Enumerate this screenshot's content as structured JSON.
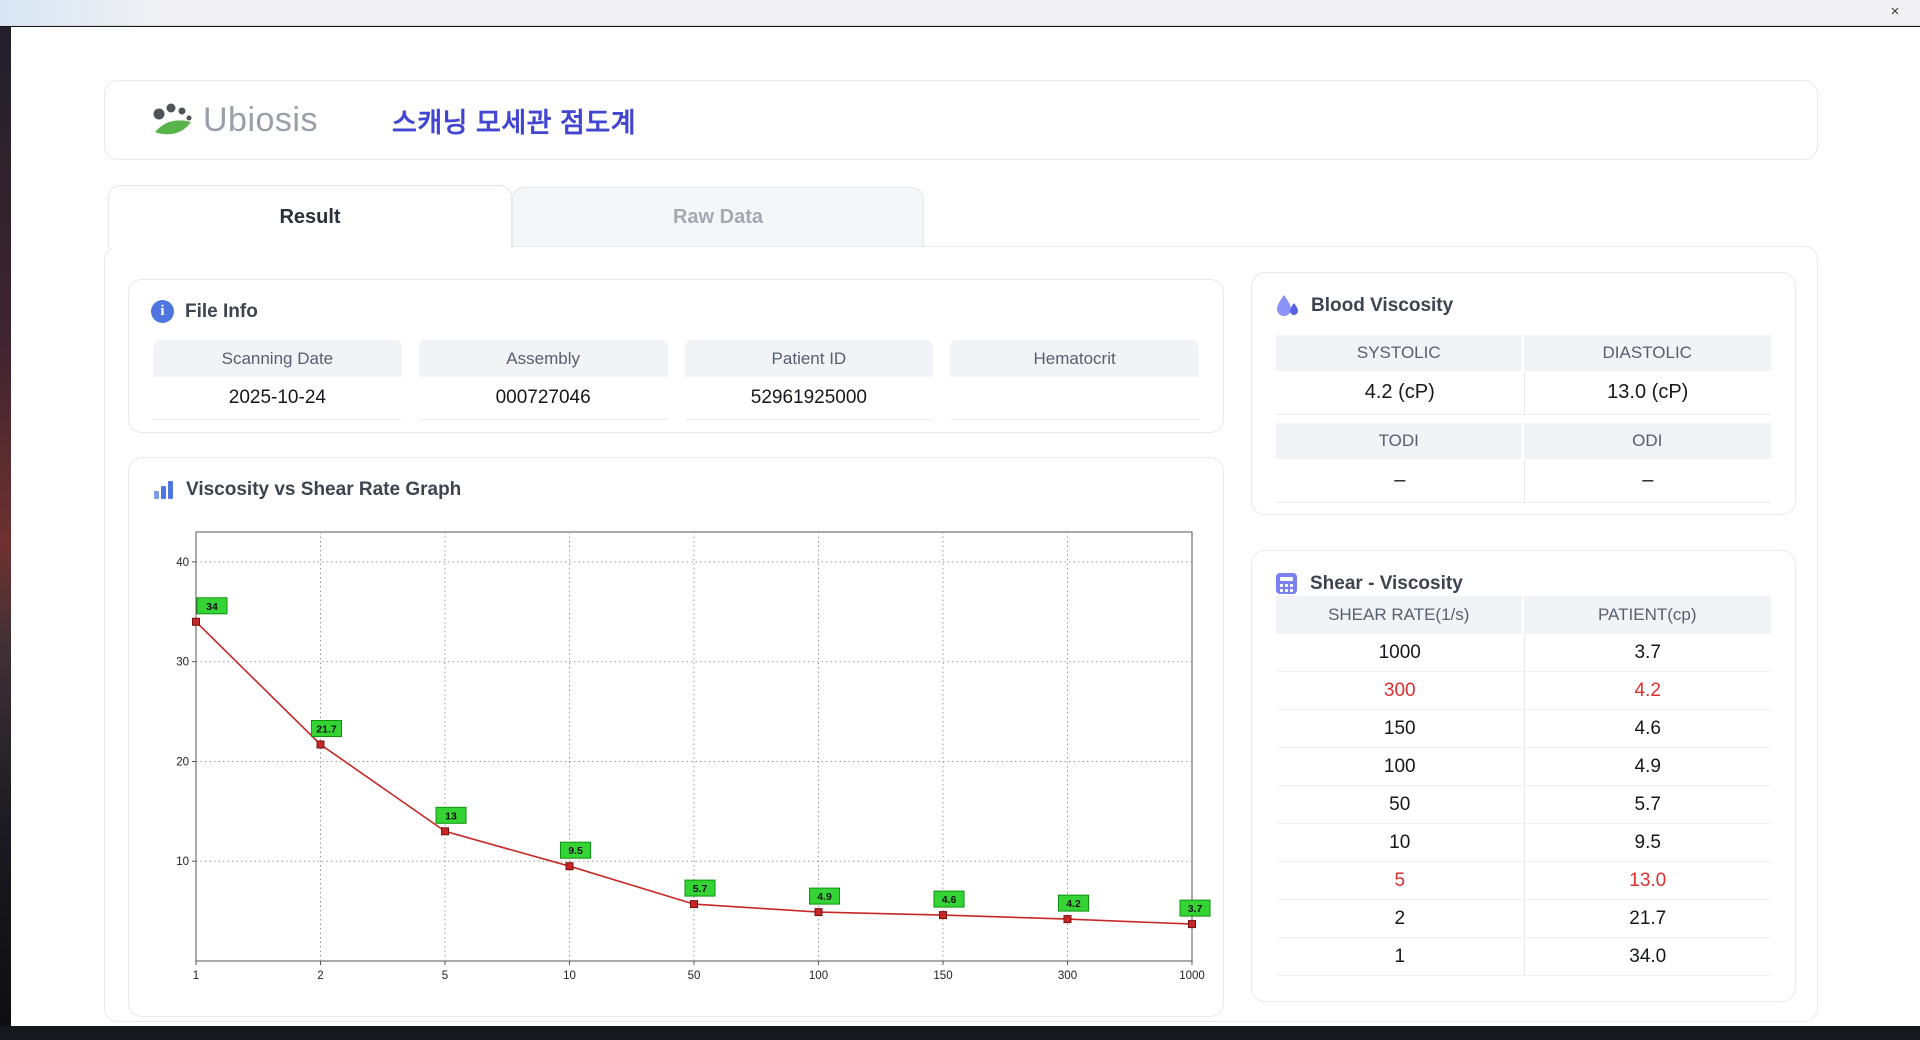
{
  "window": {
    "close_label": "×"
  },
  "header": {
    "logo": "Ubiosis",
    "title": "스캐닝 모세관 점도계"
  },
  "tabs": [
    {
      "label": "Result",
      "active": true
    },
    {
      "label": "Raw Data",
      "active": false
    }
  ],
  "file_info": {
    "title": "File Info",
    "fields": [
      {
        "label": "Scanning Date",
        "value": "2025-10-24"
      },
      {
        "label": "Assembly",
        "value": "000727046"
      },
      {
        "label": "Patient ID",
        "value": "52961925000"
      },
      {
        "label": "Hematocrit",
        "value": ""
      }
    ]
  },
  "blood_viscosity": {
    "title": "Blood Viscosity",
    "cells": [
      {
        "label": "SYSTOLIC",
        "value": "4.2 (cP)"
      },
      {
        "label": "DIASTOLIC",
        "value": "13.0 (cP)"
      },
      {
        "label": "TODI",
        "value": "–"
      },
      {
        "label": "ODI",
        "value": "–"
      }
    ]
  },
  "graph": {
    "title": "Viscosity vs Shear Rate Graph"
  },
  "chart_data": {
    "type": "line",
    "title": "Viscosity vs Shear Rate Graph",
    "x_scale": "categorical",
    "x": [
      1,
      2,
      5,
      10,
      50,
      100,
      150,
      300,
      1000
    ],
    "values": [
      34,
      21.7,
      13,
      9.5,
      5.7,
      4.9,
      4.6,
      4.2,
      3.7
    ],
    "point_labels": [
      "34",
      "21.7",
      "13",
      "9.5",
      "5.7",
      "4.9",
      "4.6",
      "4.2",
      "3.7"
    ],
    "xlabel": "",
    "ylabel": "",
    "ylim": [
      0,
      43
    ],
    "yticks": [
      10,
      20,
      30,
      40
    ],
    "grid": true,
    "line_color": "#c62828",
    "marker_color": "#c62828",
    "marker_edge": "#7a0f0f",
    "label_bg": "#35d435",
    "label_border": "#0e930e"
  },
  "shear_table": {
    "title": "Shear - Viscosity",
    "columns": [
      "SHEAR RATE(1/s)",
      "PATIENT(cp)"
    ],
    "rows": [
      {
        "shear": "1000",
        "patient": "3.7",
        "highlight": false
      },
      {
        "shear": "300",
        "patient": "4.2",
        "highlight": true
      },
      {
        "shear": "150",
        "patient": "4.6",
        "highlight": false
      },
      {
        "shear": "100",
        "patient": "4.9",
        "highlight": false
      },
      {
        "shear": "50",
        "patient": "5.7",
        "highlight": false
      },
      {
        "shear": "10",
        "patient": "9.5",
        "highlight": false
      },
      {
        "shear": "5",
        "patient": "13.0",
        "highlight": true
      },
      {
        "shear": "2",
        "patient": "21.7",
        "highlight": false
      },
      {
        "shear": "1",
        "patient": "34.0",
        "highlight": false
      }
    ]
  },
  "icons": {
    "logo": "leaf-dots-icon",
    "file_info": "info-icon",
    "blood": "droplet-icon",
    "graph": "bar-chart-icon",
    "shear": "calculator-icon",
    "close": "close-icon"
  },
  "colors": {
    "accent_blue_title": "#4145d1",
    "highlight_red": "#de2f2f",
    "chart_line_red": "#c62828",
    "chart_label_green": "#35d435",
    "header_gray_bg": "#f1f3f6"
  }
}
